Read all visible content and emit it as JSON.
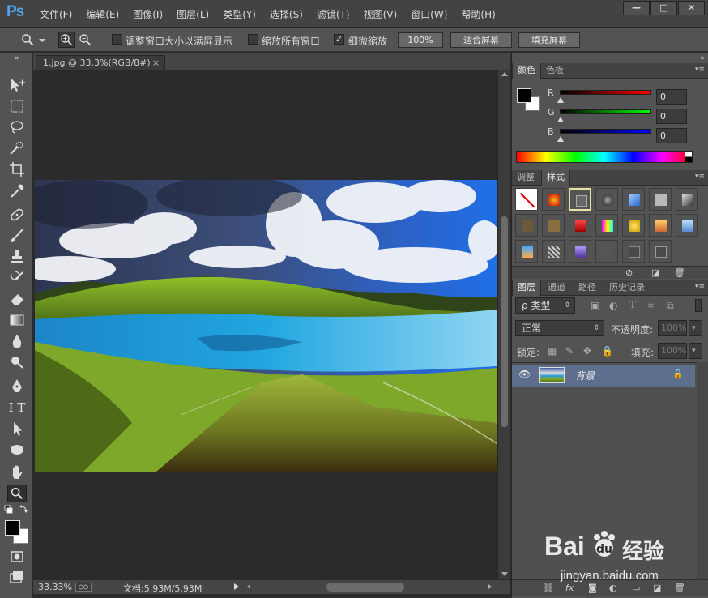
{
  "app": {
    "logo": "Ps"
  },
  "menu": [
    "文件(F)",
    "编辑(E)",
    "图像(I)",
    "图层(L)",
    "类型(Y)",
    "选择(S)",
    "滤镜(T)",
    "视图(V)",
    "窗口(W)",
    "帮助(H)"
  ],
  "window_controls": {
    "minimize": "—",
    "restore": "□",
    "close": "✕"
  },
  "options": {
    "resize_windows_label": "调整窗口大小以满屏显示",
    "zoom_all_label": "缩放所有窗口",
    "scrubby_zoom_label": "细微缩放",
    "scrubby_check": "✓",
    "btn_100": "100%",
    "btn_fit": "适合屏幕",
    "btn_fill": "填充屏幕"
  },
  "document": {
    "tab_title": "1.jpg @ 33.3%(RGB/8#)",
    "close": "×"
  },
  "status": {
    "zoom": "33.33%",
    "doc_size": "文档:5.93M/5.93M"
  },
  "color_panel": {
    "tabs": [
      "颜色",
      "色板"
    ],
    "sliders": [
      {
        "label": "R",
        "value": "0"
      },
      {
        "label": "G",
        "value": "0"
      },
      {
        "label": "B",
        "value": "0"
      }
    ]
  },
  "styles_panel": {
    "tabs": [
      "调整",
      "样式"
    ]
  },
  "layers_panel": {
    "tabs": [
      "图层",
      "通道",
      "路径",
      "历史记录"
    ],
    "filter_kind": "ρ 类型",
    "blend_mode": "正常",
    "opacity_label": "不透明度:",
    "opacity_value": "100%",
    "lock_label": "锁定:",
    "fill_label": "填充:",
    "fill_value": "100%",
    "layers": [
      {
        "name": "背景"
      }
    ]
  },
  "watermark": {
    "brand": "Bai",
    "brand_cn": "经验",
    "url": "jingyan.baidu.com"
  },
  "colors": {
    "accent": "#4fa3e8",
    "layer_selected": "#5d6f8c"
  }
}
